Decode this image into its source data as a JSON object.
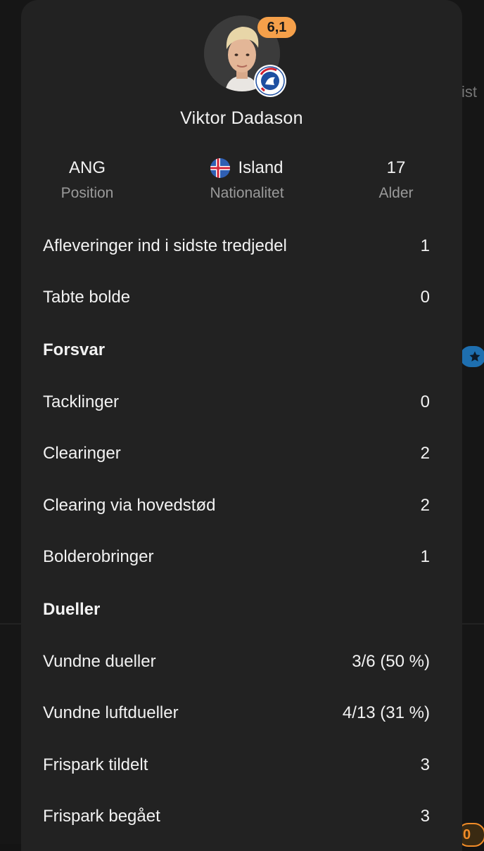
{
  "player": {
    "name": "Viktor Dadason",
    "rating": "6,1",
    "club_logo": "fc-kobenhavn-crest-icon",
    "club_logo_text": "F.C. KØBENHAVN"
  },
  "info": [
    {
      "value": "ANG",
      "label": "Position"
    },
    {
      "value": "Island",
      "label": "Nationalitet",
      "flag": "iceland-flag-icon"
    },
    {
      "value": "17",
      "label": "Alder"
    }
  ],
  "stats_top": [
    {
      "label": "Afleveringer ind i sidste tredjedel",
      "value": "1"
    },
    {
      "label": "Tabte bolde",
      "value": "0"
    }
  ],
  "sections": [
    {
      "title": "Forsvar",
      "rows": [
        {
          "label": "Tacklinger",
          "value": "0"
        },
        {
          "label": "Clearinger",
          "value": "2"
        },
        {
          "label": "Clearing via hovedstød",
          "value": "2"
        },
        {
          "label": "Bolderobringer",
          "value": "1"
        }
      ]
    },
    {
      "title": "Dueller",
      "rows": [
        {
          "label": "Vundne dueller",
          "value": "3/6 (50 %)"
        },
        {
          "label": "Vundne luftdueller",
          "value": "4/13 (31 %)"
        },
        {
          "label": "Frispark tildelt",
          "value": "3"
        },
        {
          "label": "Frispark begået",
          "value": "3"
        }
      ]
    }
  ],
  "background": {
    "right_text_fragment": "ist",
    "bottom_chip_text": "0"
  },
  "colors": {
    "card": "#222222",
    "rating_badge": "#f5a04a",
    "label_secondary": "#9a9a9a",
    "background": "#161616"
  }
}
